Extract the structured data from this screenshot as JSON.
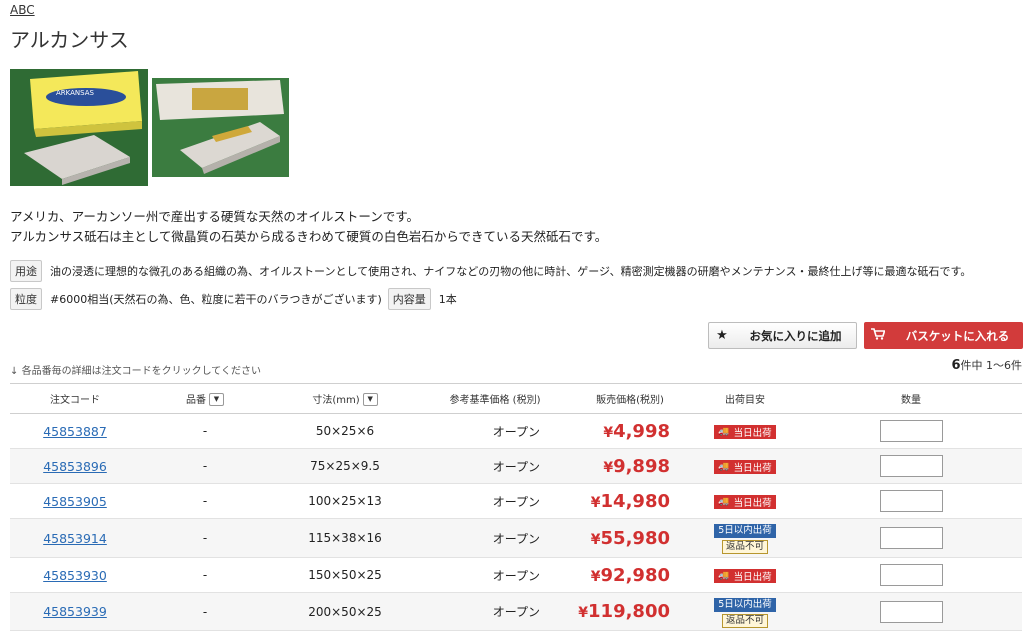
{
  "brand": "ABC",
  "title": "アルカンサス",
  "images": [
    {
      "box_label": "ARKANSAS",
      "alt": "product-image-1"
    },
    {
      "box_label": "",
      "alt": "product-image-2"
    }
  ],
  "description": [
    "アメリカ、アーカンソー州で産出する硬質な天然のオイルストーンです。",
    "アルカンサス砥石は主として微晶質の石英から成るきわめて硬質の白色岩石からできている天然砥石です。"
  ],
  "specs": {
    "usage_tag": "用途",
    "usage_text": "油の浸透に理想的な微孔のある組織の為、オイルストーンとして使用され、ナイフなどの刃物の他に時計、ゲージ、精密測定機器の研磨やメンテナンス・最終仕上げ等に最適な砥石です。",
    "grit_tag": "粒度",
    "grit_text": "#6000相当(天然石の為、色、粒度に若干のバラつきがございます)",
    "content_tag": "内容量",
    "content_text": "1本"
  },
  "buttons": {
    "favorite": "お気に入りに追加",
    "basket": "バスケットに入れる"
  },
  "hint": "各品番毎の詳細は注文コードをクリックしてください",
  "count": {
    "total": "6",
    "suffix": "件中 1〜6件"
  },
  "table": {
    "headers": {
      "code": "注文コード",
      "part": "品番",
      "size": "寸法(mm)",
      "ref_price": "参考基準価格 (税別)",
      "price": "販売価格(税別)",
      "ship": "出荷目安",
      "qty": "数量"
    },
    "rows": [
      {
        "code": "45853887",
        "part": "-",
        "size": "50×25×6",
        "ref": "オープン",
        "price": "4,998",
        "ship_type": "same_day",
        "ship_text": "当日出荷",
        "extra": ""
      },
      {
        "code": "45853896",
        "part": "-",
        "size": "75×25×9.5",
        "ref": "オープン",
        "price": "9,898",
        "ship_type": "same_day",
        "ship_text": "当日出荷",
        "extra": ""
      },
      {
        "code": "45853905",
        "part": "-",
        "size": "100×25×13",
        "ref": "オープン",
        "price": "14,980",
        "ship_type": "same_day",
        "ship_text": "当日出荷",
        "extra": ""
      },
      {
        "code": "45853914",
        "part": "-",
        "size": "115×38×16",
        "ref": "オープン",
        "price": "55,980",
        "ship_type": "within_5",
        "ship_text": "5日以内出荷",
        "extra": "返品不可"
      },
      {
        "code": "45853930",
        "part": "-",
        "size": "150×50×25",
        "ref": "オープン",
        "price": "92,980",
        "ship_type": "same_day",
        "ship_text": "当日出荷",
        "extra": ""
      },
      {
        "code": "45853939",
        "part": "-",
        "size": "200×50×25",
        "ref": "オープン",
        "price": "119,800",
        "ship_type": "within_5",
        "ship_text": "5日以内出荷",
        "extra": "返品不可"
      }
    ]
  },
  "currency": "¥",
  "colors": {
    "price": "#d13030",
    "basket": "#d23b3b",
    "link": "#2a6bb5",
    "badge_blue": "#2f64a8"
  }
}
